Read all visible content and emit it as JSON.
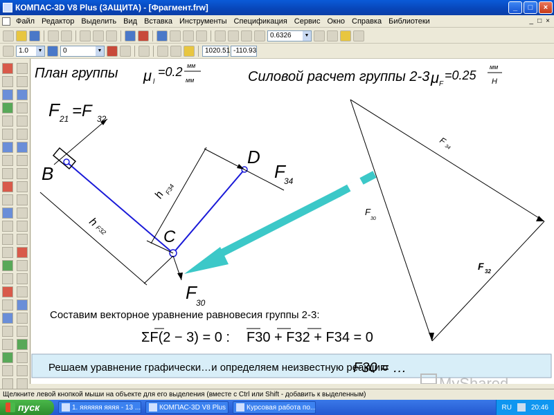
{
  "window": {
    "title": "КОМПАС-3D V8 Plus (ЗАЩИТА) - [Фрагмент.frw]",
    "minimize": "_",
    "maximize": "□",
    "close": "×"
  },
  "menu": {
    "items": [
      "Файл",
      "Редактор",
      "Выделить",
      "Вид",
      "Вставка",
      "Инструменты",
      "Спецификация",
      "Сервис",
      "Окно",
      "Справка",
      "Библиотеки"
    ],
    "mdi_minimize": "_",
    "mdi_restore": "□",
    "mdi_close": "×"
  },
  "toolbar1": {
    "zoom_value": "0.6326"
  },
  "toolbar2": {
    "scale_value": "1.0",
    "layer_value": "0",
    "coord_x": "1020.51",
    "coord_y": "-110.93"
  },
  "drawing": {
    "left_title": "План группы",
    "mu_l": "μ",
    "mu_l_sub": "l",
    "mu_l_value": "=0.2",
    "mu_l_unit_top": "мм",
    "mu_l_unit_bottom": "мм",
    "right_title": "Силовой расчет группы 2-3",
    "mu_f": "μ",
    "mu_f_sub": "F",
    "mu_f_value": "=0.25",
    "mu_f_unit_top": "мм",
    "mu_f_unit_bottom": "Н",
    "f21_label": "F",
    "f21_sub": "21",
    "f21_eq": "=F",
    "f21_eq_sub": "32",
    "point_b": "B",
    "point_c": "C",
    "point_d": "D",
    "f34_label": "F",
    "f34_sub": "34",
    "f30_label": "F",
    "f30_sub": "30",
    "h_f34": "h",
    "h_f34_sub": "F34",
    "h_f32": "h",
    "h_f32_sub": "F32",
    "tri_f34": "F",
    "tri_f34_sub": "34",
    "tri_f30": "F",
    "tri_f30_sub": "30",
    "tri_f32": "F",
    "tri_f32_sub": "32",
    "equation_heading": "Составим векторное уравнение равновесия группы 2-3:",
    "equation_sum": "ΣF(2 − 3) = 0 :",
    "equation_rhs": "F30 + F32 + F34 = 0",
    "solution_text": "Решаем уравнение графически…и определяем неизвестную реакцию",
    "solution_result": "F30 = …",
    "watermark": "MyShared"
  },
  "status": {
    "text": "Щелкните левой кнопкой мыши на объекте для его выделения (вместе с Ctrl или Shift - добавить к выделенным)"
  },
  "taskbar": {
    "start": "пуск",
    "tasks": [
      "1. яяяяяя яяяя - 13 ...",
      "КОМПАС-3D V8 Plus ...",
      "Курсовая работа по..."
    ],
    "lang": "RU",
    "clock": "20:46"
  },
  "colors": {
    "link_blue": "#1a1ad8",
    "arrow_teal": "#3cc8c8",
    "titlebar": "#0a5bd8"
  }
}
